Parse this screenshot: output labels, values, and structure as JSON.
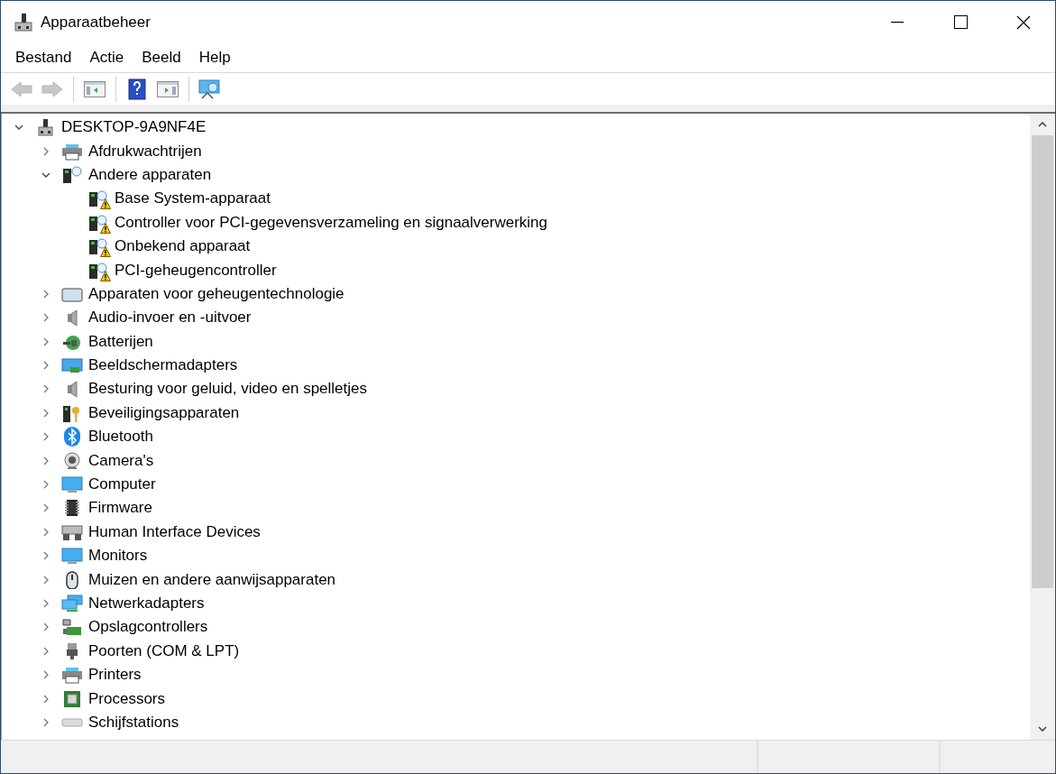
{
  "window": {
    "title": "Apparaatbeheer"
  },
  "menu": [
    {
      "label": "Bestand"
    },
    {
      "label": "Actie"
    },
    {
      "label": "Beeld"
    },
    {
      "label": "Help"
    }
  ],
  "toolbar": [
    {
      "kind": "back",
      "disabled": true
    },
    {
      "kind": "forward",
      "disabled": true
    },
    {
      "kind": "separator"
    },
    {
      "kind": "hide-tree",
      "disabled": false
    },
    {
      "kind": "separator"
    },
    {
      "kind": "help",
      "disabled": false
    },
    {
      "kind": "show-tree",
      "disabled": false
    },
    {
      "kind": "separator"
    },
    {
      "kind": "scan",
      "disabled": false
    }
  ],
  "tree": [
    {
      "label": "DESKTOP-9A9NF4E",
      "kind": "computer",
      "expanded": true,
      "children": [
        {
          "label": "Afdrukwachtrijen",
          "kind": "printer",
          "expanded": false
        },
        {
          "label": "Andere apparaten",
          "kind": "unknown",
          "expanded": true,
          "children": [
            {
              "label": "Base System-apparaat",
              "kind": "device",
              "warning": true
            },
            {
              "label": "Controller voor PCI-gegevensverzameling en signaalverwerking",
              "kind": "device",
              "warning": true
            },
            {
              "label": "Onbekend apparaat",
              "kind": "device",
              "warning": true
            },
            {
              "label": "PCI-geheugencontroller",
              "kind": "device",
              "warning": true
            }
          ]
        },
        {
          "label": "Apparaten voor geheugentechnologie",
          "kind": "memory",
          "expanded": false
        },
        {
          "label": "Audio-invoer en -uitvoer",
          "kind": "speaker",
          "expanded": false
        },
        {
          "label": "Batterijen",
          "kind": "battery",
          "expanded": false
        },
        {
          "label": "Beeldschermadapters",
          "kind": "display",
          "expanded": false
        },
        {
          "label": "Besturing voor geluid, video en spelletjes",
          "kind": "speaker",
          "expanded": false
        },
        {
          "label": "Beveiligingsapparaten",
          "kind": "security",
          "expanded": false
        },
        {
          "label": "Bluetooth",
          "kind": "bluetooth",
          "expanded": false
        },
        {
          "label": "Camera's",
          "kind": "camera",
          "expanded": false
        },
        {
          "label": "Computer",
          "kind": "monitor",
          "expanded": false
        },
        {
          "label": "Firmware",
          "kind": "chip",
          "expanded": false
        },
        {
          "label": "Human Interface Devices",
          "kind": "hid",
          "expanded": false
        },
        {
          "label": "Monitors",
          "kind": "monitor",
          "expanded": false
        },
        {
          "label": "Muizen en andere aanwijsapparaten",
          "kind": "mouse",
          "expanded": false
        },
        {
          "label": "Netwerkadapters",
          "kind": "network",
          "expanded": false
        },
        {
          "label": "Opslagcontrollers",
          "kind": "storage",
          "expanded": false
        },
        {
          "label": "Poorten (COM & LPT)",
          "kind": "port",
          "expanded": false
        },
        {
          "label": "Printers",
          "kind": "printer",
          "expanded": false
        },
        {
          "label": "Processors",
          "kind": "processor",
          "expanded": false
        },
        {
          "label": "Schijfstations",
          "kind": "drive",
          "expanded": false
        }
      ]
    }
  ]
}
